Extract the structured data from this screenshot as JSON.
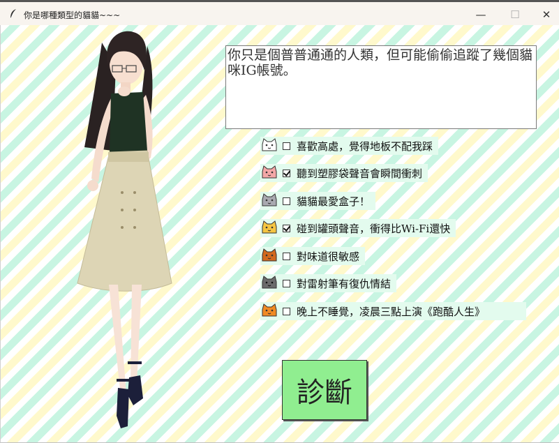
{
  "window": {
    "title": "你是哪種類型的貓貓~~~",
    "min_label": "—",
    "max_label": "☐",
    "close_label": "✕"
  },
  "result": {
    "text": "你只是個普普通通的人類，但可能偷偷追蹤了幾個貓咪IG帳號。"
  },
  "options": [
    {
      "label": "喜歡高處，覺得地板不配我踩",
      "checked": false,
      "cat_color": "#ffffff"
    },
    {
      "label": "聽到塑膠袋聲音會瞬間衝刺",
      "checked": true,
      "cat_color": "#f4a7a7"
    },
    {
      "label": "貓貓最愛盒子！",
      "checked": false,
      "cat_color": "#a9a9b0"
    },
    {
      "label": "碰到罐頭聲音，衝得比Wi-Fi還快",
      "checked": true,
      "cat_color": "#f5c542"
    },
    {
      "label": "對味道很敏感",
      "checked": false,
      "cat_color": "#d2691e"
    },
    {
      "label": "對雷射筆有復仇情結",
      "checked": false,
      "cat_color": "#6b6b6b"
    },
    {
      "label": "晚上不睡覺，凌晨三點上演《跑酷人生》",
      "checked": false,
      "cat_color": "#f08a24"
    }
  ],
  "diagnose_button": {
    "label": "診斷",
    "color": "#90ee90"
  }
}
